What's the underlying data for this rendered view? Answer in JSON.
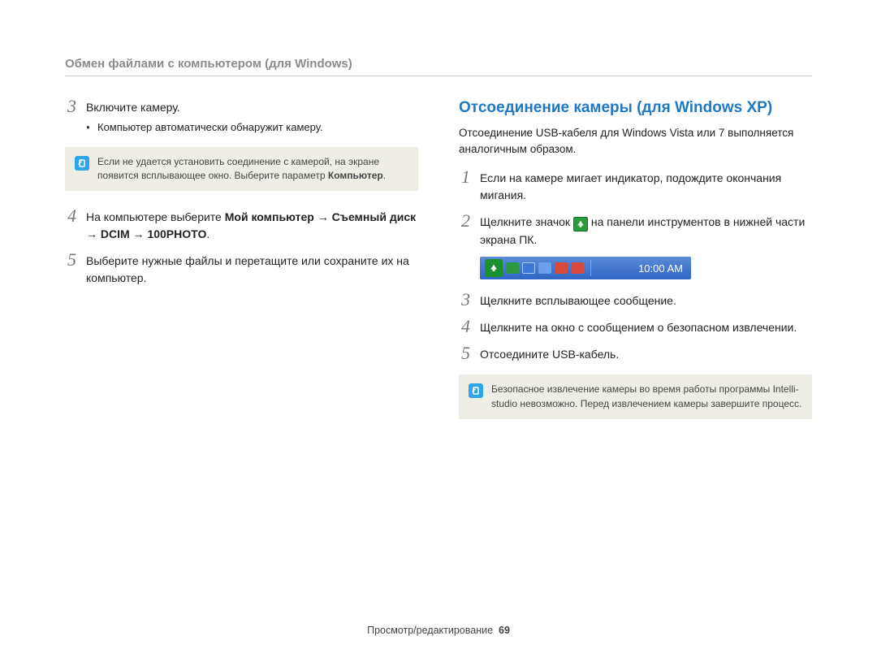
{
  "header": {
    "title": "Обмен файлами с компьютером (для Windows)"
  },
  "left": {
    "steps": [
      {
        "num": "3",
        "text": "Включите камеру.",
        "bullet": "Компьютер автоматически обнаружит камеру."
      },
      {
        "num": "4",
        "prefix": "На компьютере выберите ",
        "bold1": "Мой компьютер",
        "arrow": " → ",
        "bold2": "Съемный диск",
        "bold3": "DCIM",
        "bold4": "100PHOTO",
        "suffix": "."
      },
      {
        "num": "5",
        "text": "Выберите нужные файлы и перетащите или сохраните их на компьютер."
      }
    ],
    "note": {
      "text_prefix": "Если не удается установить соединение с камерой, на экране появится всплывающее окно. Выберите параметр ",
      "text_bold": "Компьютер",
      "text_suffix": "."
    }
  },
  "right": {
    "title": "Отсоединение камеры (для Windows XP)",
    "intro": "Отсоединение USB-кабеля для Windows Vista или 7 выполняется аналогичным образом.",
    "steps": [
      {
        "num": "1",
        "text": "Если на камере мигает индикатор, подождите окончания мигания."
      },
      {
        "num": "2",
        "prefix": "Щелкните значок ",
        "suffix": " на панели инструментов в нижней части экрана ПК."
      },
      {
        "num": "3",
        "text": "Щелкните всплывающее сообщение."
      },
      {
        "num": "4",
        "text": "Щелкните на окно с сообщением о безопасном извлечении."
      },
      {
        "num": "5",
        "text": "Отсоедините USB-кабель."
      }
    ],
    "tray_time": "10:00 AM",
    "note": {
      "text": "Безопасное извлечение камеры во время работы программы Intelli-studio невозможно. Перед извлечением камеры завершите процесс."
    }
  },
  "footer": {
    "label": "Просмотр/редактирование",
    "page": "69"
  }
}
